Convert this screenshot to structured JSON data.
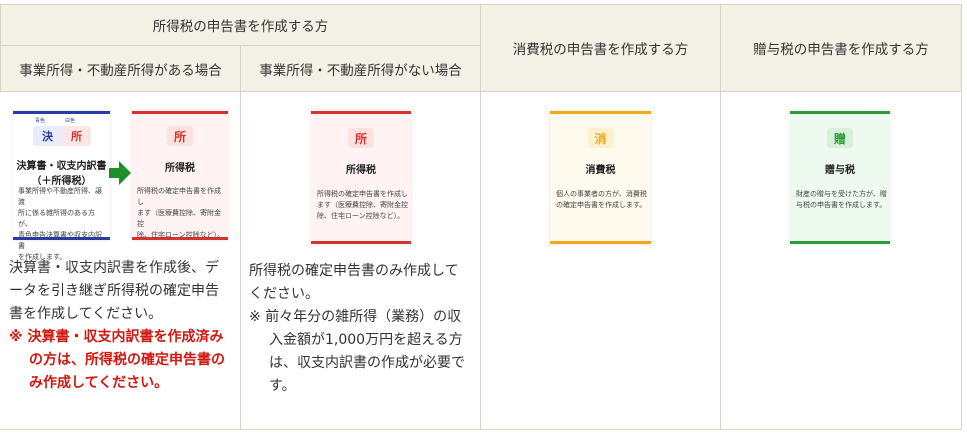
{
  "headers": {
    "income_tax_group": "所得税の申告書を作成する方",
    "with_business": "事業所得・不動産所得がある場合",
    "without_business": "事業所得・不動産所得がない場合",
    "consumption": "消費税の申告書を作成する方",
    "gift": "贈与税の申告書を作成する方"
  },
  "cards": {
    "settlement": {
      "small1": "青色",
      "small2": "白色",
      "badge1": "決",
      "badge2": "所",
      "title1": "決算書・収支内訳書",
      "title2": "（＋所得税）",
      "desc": "事業所得や不動産所得、譲渡所得（山林所得）のある方が、青色申告決算書や収支内訳書を作成します。",
      "desc_l1": "事業所得や不動産所得、譲渡",
      "desc_l2": "所に係る雑所得のある方が、",
      "desc_l3": "青色申告決算書や収支内訳書",
      "desc_l4": "を作成します。",
      "accent": "#2a3aa8"
    },
    "income_a": {
      "badge": "所",
      "title": "所得税",
      "desc_l1": "所得税の確定申告書を作成し",
      "desc_l2": "ます（医療費控除、寄附金控",
      "desc_l3": "除、住宅ローン控除など）。",
      "accent": "#d9322c"
    },
    "income_b": {
      "badge": "所",
      "title": "所得税",
      "desc_l1": "所得税の確定申告書を作成し",
      "desc_l2": "ます（医療費控除、寄附金控",
      "desc_l3": "除、住宅ローン控除など）。",
      "accent": "#d9322c"
    },
    "consumption": {
      "badge": "消",
      "title": "消費税",
      "desc_l1": "個人の事業者の方が、消費税",
      "desc_l2": "の確定申告書を作成します。",
      "accent": "#f2a818"
    },
    "gift": {
      "badge": "贈",
      "title": "贈与税",
      "desc_l1": "財産の贈与を受けた方が、贈",
      "desc_l2": "与税の申告書を作成します。",
      "accent": "#2d9a36"
    }
  },
  "notes": {
    "col1_l1": "決算書・収支内訳書を作成後、デ",
    "col1_l2": "ータを引き継ぎ所得税の確定申告",
    "col1_l3": "書を作成してください。",
    "col1_red1": "※ 決算書・収支内訳書を作成済み",
    "col1_red2": "の方は、所得税の確定申告書の",
    "col1_red3": "み作成してください。",
    "col2_l1": "所得税の確定申告書のみ作成して",
    "col2_l2": "ください。",
    "col2_n1": "※ 前々年分の雑所得（業務）の収",
    "col2_n2": "入金額が1,000万円を超える方",
    "col2_n3": "は、収支内訳書の作成が必要で",
    "col2_n4": "す。"
  }
}
